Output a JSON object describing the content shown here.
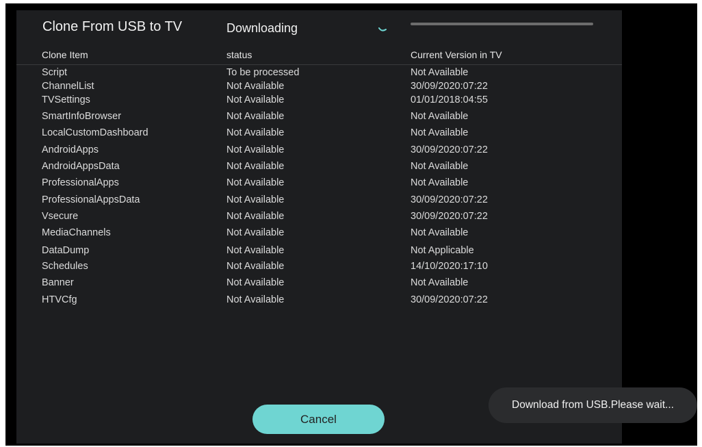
{
  "dialog": {
    "title": "Clone From USB to TV",
    "download_status": "Downloading",
    "progress": 0.0
  },
  "table": {
    "headers": [
      "Clone Item",
      "status",
      "Current Version in TV"
    ],
    "rows": [
      [
        "Script",
        "To be processed",
        "Not Available"
      ],
      [
        "ChannelList",
        "Not Available",
        "30/09/2020:07:22"
      ],
      [
        "TVSettings",
        "Not Available",
        "01/01/2018:04:55"
      ],
      [
        "SmartInfoBrowser",
        "Not Available",
        "Not Available"
      ],
      [
        "LocalCustomDashboard",
        "Not Available",
        "Not Available"
      ],
      [
        "AndroidApps",
        "Not Available",
        "30/09/2020:07:22"
      ],
      [
        "AndroidAppsData",
        "Not Available",
        "Not Available"
      ],
      [
        "ProfessionalApps",
        "Not Available",
        "Not Available"
      ],
      [
        "ProfessionalAppsData",
        "Not Available",
        "30/09/2020:07:22"
      ],
      [
        "Vsecure",
        "Not Available",
        "30/09/2020:07:22"
      ],
      [
        "MediaChannels",
        "Not Available",
        "Not Available"
      ],
      [
        "DataDump",
        "Not Available",
        "Not Applicable"
      ],
      [
        "Schedules",
        "Not Available",
        "14/10/2020:17:10"
      ],
      [
        "Banner",
        "Not Available",
        "Not Available"
      ],
      [
        "HTVCfg",
        "Not Available",
        "30/09/2020:07:22"
      ]
    ]
  },
  "buttons": {
    "cancel": "Cancel"
  },
  "toast": {
    "message": "Download from USB.Please wait..."
  },
  "colors": {
    "accent": "#6fd5d2",
    "panel": "#1d1e20",
    "background": "#000000"
  }
}
